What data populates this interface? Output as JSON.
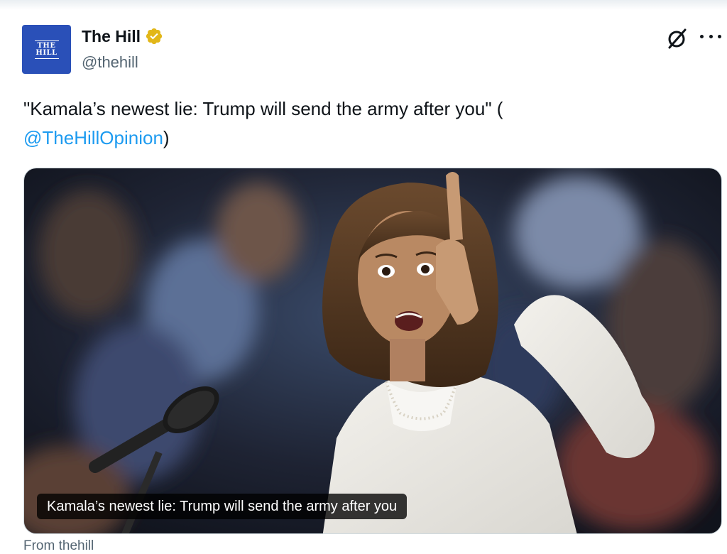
{
  "tweet": {
    "author": {
      "display_name": "The Hill",
      "handle": "@thehill",
      "avatar_text": "THE HILL",
      "verified": true
    },
    "text_before_mention": "\"Kamala’s newest lie: Trump will send the army after you\" (",
    "mention": "@TheHillOpinion",
    "text_after_mention": ")",
    "media": {
      "caption": "Kamala’s newest lie: Trump will send the army after you"
    },
    "from_text": "From thehill"
  },
  "icons": {
    "verified": "verified-gold-badge-icon",
    "grok": "grok-icon",
    "more": "more-dots-icon"
  },
  "colors": {
    "link": "#1d9bf0",
    "secondary_text": "#536471",
    "avatar_bg": "#2a50b8",
    "badge": "#e2b719"
  }
}
